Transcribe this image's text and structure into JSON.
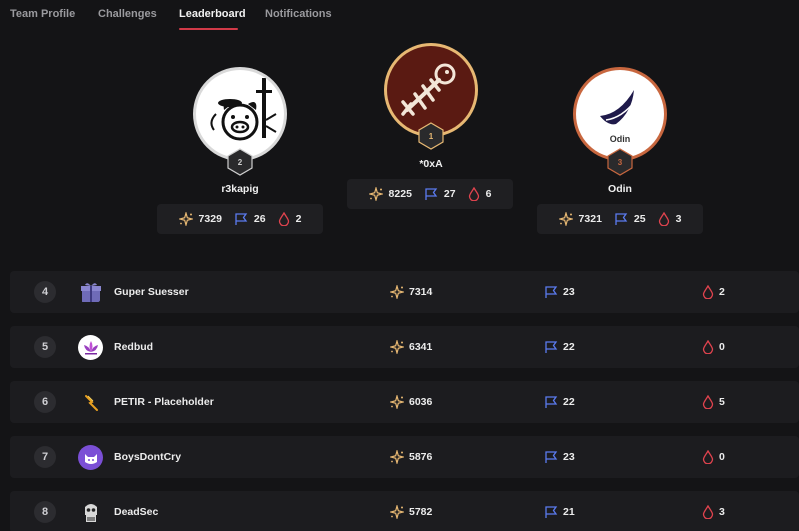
{
  "tabs": [
    {
      "label": "Team Profile"
    },
    {
      "label": "Challenges"
    },
    {
      "label": "Leaderboard"
    },
    {
      "label": "Notifications"
    }
  ],
  "active_tab": "Leaderboard",
  "podium": {
    "first": {
      "rank": "1",
      "name": "*0xA",
      "points": "8225",
      "flags": "27",
      "bloods": "6"
    },
    "second": {
      "rank": "2",
      "name": "r3kapig",
      "points": "7329",
      "flags": "26",
      "bloods": "2"
    },
    "third": {
      "rank": "3",
      "name": "Odin",
      "points": "7321",
      "flags": "25",
      "bloods": "3",
      "avatar_text": "Odin"
    }
  },
  "rows": [
    {
      "rank": "4",
      "name": "Guper Suesser",
      "points": "7314",
      "flags": "23",
      "bloods": "2"
    },
    {
      "rank": "5",
      "name": "Redbud",
      "points": "6341",
      "flags": "22",
      "bloods": "0"
    },
    {
      "rank": "6",
      "name": "PETIR - Placeholder",
      "points": "6036",
      "flags": "22",
      "bloods": "5"
    },
    {
      "rank": "7",
      "name": "BoysDontCry",
      "points": "5876",
      "flags": "23",
      "bloods": "0"
    },
    {
      "rank": "8",
      "name": "DeadSec",
      "points": "5782",
      "flags": "21",
      "bloods": "3"
    }
  ],
  "colors": {
    "accent": "#d13a48",
    "gold": "#e7b873",
    "flag": "#5b7bf0",
    "blood": "#e0434e",
    "silver": "#cfcfcf",
    "bronze": "#c8673f"
  },
  "icons": {
    "points": "sparkle-icon",
    "flags": "flag-icon",
    "bloods": "blood-drop-icon"
  }
}
